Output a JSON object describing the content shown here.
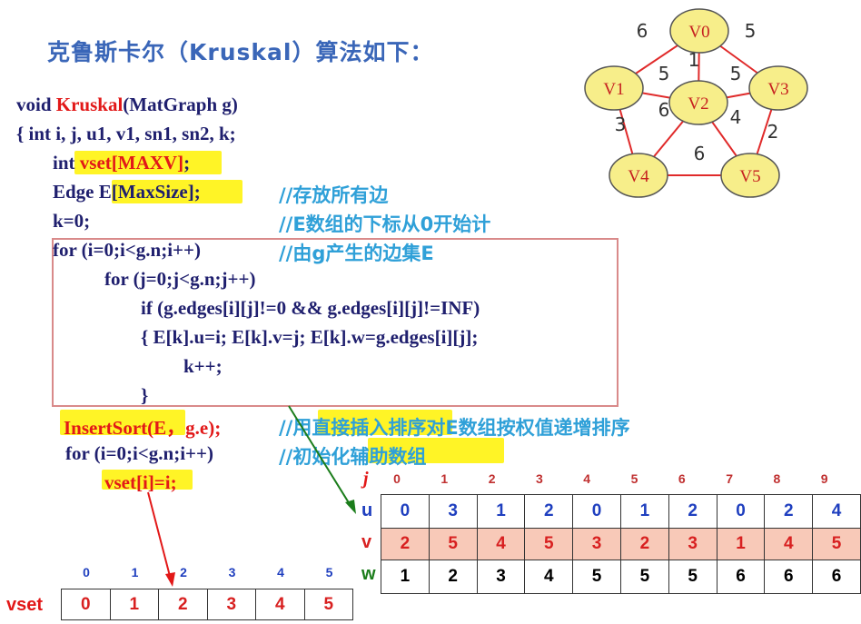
{
  "title": "克鲁斯卡尔（Kruskal）算法如下：",
  "code": {
    "l1_void": "void ",
    "l1_fn": "Kruskal",
    "l1_rest": "(MatGraph g)",
    "l2": "{    int i,  j,  u1,  v1,  sn1,  sn2,  k;",
    "l3_a": "int ",
    "l3_b": "vset[MAXV]",
    "l3_c": ";",
    "l4_a": "Edge ",
    "l4_b": "E[MaxSize];",
    "l4_comment": "//存放所有边",
    "l5": "k=0;",
    "l5_comment": "//E数组的下标从0开始计",
    "l6": "for (i=0;i<g.n;i++)",
    "l6_comment": "//由g产生的边集E",
    "l7": "for (j=0;j<g.n;j++)",
    "l8": "if (g.edges[i][j]!=0 && g.edges[i][j]!=INF)",
    "l9": "{     E[k].u=i;  E[k].v=j;  E[k].w=g.edges[i][j];",
    "l10": "k++;",
    "l11": "}",
    "l12_fn": "InsertSort(E，g.e);",
    "l12_comment": "//用直接插入排序对E数组按权值递增排序",
    "l13": "for (i=0;i<g.n;i++)",
    "l13_comment": "//初始化辅助数组",
    "l14": "vset[i]=i;"
  },
  "graph": {
    "nodes": [
      "V0",
      "V1",
      "V2",
      "V3",
      "V4",
      "V5"
    ],
    "edges": [
      {
        "from": "V0",
        "to": "V1",
        "w": 6
      },
      {
        "from": "V0",
        "to": "V3",
        "w": 5
      },
      {
        "from": "V0",
        "to": "V2",
        "w": 1
      },
      {
        "from": "V1",
        "to": "V2",
        "w": 5
      },
      {
        "from": "V2",
        "to": "V3",
        "w": 5
      },
      {
        "from": "V1",
        "to": "V4",
        "w": 3
      },
      {
        "from": "V2",
        "to": "V4",
        "w": 6
      },
      {
        "from": "V2",
        "to": "V5",
        "w": 4
      },
      {
        "from": "V3",
        "to": "V5",
        "w": 2
      },
      {
        "from": "V4",
        "to": "V5",
        "w": 6
      }
    ]
  },
  "edge_table": {
    "index_label": "j",
    "indices": [
      "0",
      "1",
      "2",
      "3",
      "4",
      "5",
      "6",
      "7",
      "8",
      "9"
    ],
    "rows": [
      {
        "label": "u",
        "values": [
          "0",
          "3",
          "1",
          "2",
          "0",
          "1",
          "2",
          "0",
          "2",
          "4"
        ]
      },
      {
        "label": "v",
        "values": [
          "2",
          "5",
          "4",
          "5",
          "3",
          "2",
          "3",
          "1",
          "4",
          "5"
        ]
      },
      {
        "label": "w",
        "values": [
          "1",
          "2",
          "3",
          "4",
          "5",
          "5",
          "5",
          "6",
          "6",
          "6"
        ]
      }
    ]
  },
  "vset_table": {
    "label": "vset",
    "indices": [
      "0",
      "1",
      "2",
      "3",
      "4",
      "5"
    ],
    "values": [
      "0",
      "1",
      "2",
      "3",
      "4",
      "5"
    ]
  },
  "colors": {
    "node_fill": "#f7ee8a",
    "edge": "#e02a2a",
    "code": "#1f1f6e",
    "comment": "#2fa0d8",
    "highlight": "#fff200"
  }
}
